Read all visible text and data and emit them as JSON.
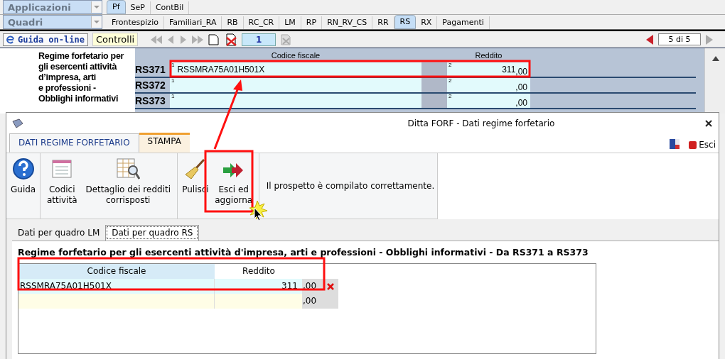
{
  "selectors": [
    {
      "label": "Applicazioni"
    },
    {
      "label": "Quadri"
    }
  ],
  "top_tabs": [
    {
      "label": "Pf",
      "selected": true
    },
    {
      "label": "SeP",
      "selected": false
    },
    {
      "label": "ContBil",
      "selected": false
    }
  ],
  "quadri_tabs": [
    {
      "label": "Frontespizio",
      "selected": false
    },
    {
      "label": "Familiari_RA",
      "selected": false
    },
    {
      "label": "RB",
      "selected": false
    },
    {
      "label": "RC_CR",
      "selected": false
    },
    {
      "label": "LM",
      "selected": false
    },
    {
      "label": "RP",
      "selected": false
    },
    {
      "label": "RN_RV_CS",
      "selected": false
    },
    {
      "label": "RR",
      "selected": false
    },
    {
      "label": "RS",
      "selected": true
    },
    {
      "label": "RX",
      "selected": false
    },
    {
      "label": "Pagamenti",
      "selected": false
    }
  ],
  "toolbar": {
    "help_link": "Guida on-line",
    "controls_button": "Controlli",
    "page_number": "1",
    "page_counter": "5 di 5"
  },
  "form": {
    "title_lines": [
      "Regime forfetario per",
      "gli esercenti attività",
      "d’impresa, arti",
      "e professioni -",
      "Obblighi informativi"
    ],
    "columns": [
      "Codice fiscale",
      "Reddito"
    ],
    "rows": [
      {
        "code": "RS371",
        "field_1_number": "1",
        "codice_fiscale": "RSSMRA75A01H501X",
        "field_2_number": "2",
        "reddito": "311",
        "decimals": ",00"
      },
      {
        "code": "RS372",
        "field_1_number": "1",
        "field_2_number": "2",
        "decimals": ",00"
      },
      {
        "code": "RS373",
        "field_1_number": "1",
        "field_2_number": "2",
        "decimals": ",00"
      }
    ]
  },
  "dialog": {
    "title": "Ditta FORF - Dati regime forfetario",
    "ribbon_tabs": [
      {
        "label": "DATI REGIME FORFETARIO",
        "selected": true
      },
      {
        "label": "STAMPA",
        "selected": false
      }
    ],
    "exit_button": "Esci",
    "ribbon_groups": [
      [
        {
          "kind": "help",
          "label": "Guida"
        }
      ],
      [
        {
          "kind": "list",
          "label": "Codici attività"
        },
        {
          "kind": "table",
          "label": "Dettaglio dei redditi corrisposti"
        }
      ],
      [
        {
          "kind": "broom",
          "label": "Pulisci"
        },
        {
          "kind": "exit",
          "label": "Esci ed aggiorna"
        }
      ]
    ],
    "status_message": "Il prospetto è compilato correttamente.",
    "sub_tabs": [
      {
        "label": "Dati per quadro LM",
        "selected": false
      },
      {
        "label": "Dati per quadro RS",
        "selected": true
      }
    ],
    "section_title": "Regime forfetario per gli esercenti attività d'impresa, arti e professioni - Obblighi informativi - Da RS371 a RS373",
    "grid": {
      "columns": [
        "Codice fiscale",
        "Reddito"
      ],
      "rows": [
        {
          "kind": "filled",
          "codice_fiscale": "RSSMRA75A01H501X",
          "reddito": "311",
          "decimals": ",00",
          "deletable": true
        },
        {
          "kind": "new",
          "decimals": ",00",
          "deletable": false
        }
      ]
    }
  }
}
